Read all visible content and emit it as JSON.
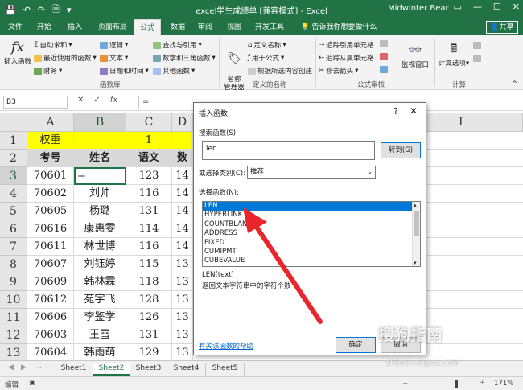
{
  "titlebar": {
    "title": "excel学生成绩单  [兼容模式]  -  Excel",
    "user": "Midwinter Bear",
    "save_icon": "save-icon",
    "undo_icon": "undo-icon",
    "redo_icon": "redo-icon",
    "new_icon": "new-file-icon",
    "customize_icon": "chevron-down-icon"
  },
  "tabs": [
    "文件",
    "开始",
    "插入",
    "页面布局",
    "公式",
    "数据",
    "审阅",
    "视图",
    "开发工具",
    "告诉我你想要做什么"
  ],
  "share_label": "共享",
  "ribbon": {
    "insert_function": "插入函数",
    "autosum": "自动求和",
    "recent": "最近使用的函数",
    "financial": "财务",
    "logical": "逻辑",
    "text": "文本",
    "datetime": "日期和时间",
    "lookup": "查找与引用",
    "math": "数学和三角函数",
    "more": "其他函数",
    "group_library": "函数库",
    "name_manager": "名称\n管理器",
    "define_name": "定义名称",
    "use_in_formula": "用于公式",
    "create_from_selection": "根据所选内容创建",
    "group_names": "定义的名称",
    "trace_precedents": "追踪引用单元格",
    "trace_dependents": "追踪从属单元格",
    "remove_arrows": "移去箭头",
    "group_audit": "公式审核",
    "watch_window": "监视窗口",
    "calc_options": "计算选项",
    "group_calc": "计算"
  },
  "formula_bar": {
    "namebox": "B3",
    "content": "="
  },
  "grid": {
    "columns": [
      "A",
      "B",
      "C",
      "D"
    ],
    "selected_column": "B",
    "row_numbers": [
      "1",
      "2",
      "3",
      "4",
      "5",
      "6",
      "7",
      "8",
      "9",
      "10",
      "11",
      "12",
      "13"
    ],
    "selected_row": "3",
    "row1": [
      "权重",
      "",
      "1",
      ""
    ],
    "headers": [
      "考号",
      "姓名",
      "语文",
      "数"
    ],
    "rows": [
      [
        "70601",
        "=",
        "123",
        "14"
      ],
      [
        "70602",
        "刘帅",
        "116",
        "14"
      ],
      [
        "70605",
        "杨璐",
        "131",
        "14"
      ],
      [
        "70616",
        "康惠雯",
        "114",
        "14"
      ],
      [
        "70611",
        "林世博",
        "116",
        "14"
      ],
      [
        "70607",
        "刘钰婷",
        "115",
        "13"
      ],
      [
        "70609",
        "韩林霖",
        "118",
        "13"
      ],
      [
        "70612",
        "苑宇飞",
        "128",
        "13"
      ],
      [
        "70606",
        "李鉴学",
        "126",
        "13"
      ],
      [
        "70603",
        "王雪",
        "131",
        "13"
      ],
      [
        "70604",
        "韩雨萌",
        "129",
        "13"
      ]
    ],
    "extra_col": "I"
  },
  "sheets": [
    "Sheet1",
    "Sheet2",
    "Sheet3",
    "Sheet4",
    "Sheet5"
  ],
  "active_sheet": "Sheet2",
  "status": {
    "mode": "编辑",
    "zoom": "171%"
  },
  "dialog": {
    "title": "插入函数",
    "search_label": "搜索函数(S):",
    "search_value": "len",
    "go_button": "转到(G)",
    "category_label": "或选择类别(C):",
    "category_value": "推荐",
    "select_label": "选择函数(N):",
    "functions": [
      "LEN",
      "HYPERLINK",
      "COUNTBLAN",
      "ADDRESS",
      "FIXED",
      "CUMIPMT",
      "CUBEVALUE"
    ],
    "selected_function": "LEN",
    "signature": "LEN(text)",
    "description": "返回文本字符串中的字符个数",
    "help_link": "有关该函数的帮助",
    "ok": "确定",
    "cancel": "取消",
    "help_glyph": "?",
    "close_glyph": "✕"
  },
  "watermark": {
    "brand": "搜狗指南",
    "url": "zhinan.sogou.com"
  },
  "colors": {
    "excel_green": "#217346",
    "yellow_fill": "#ffff00",
    "header_fill": "#d9d9d9",
    "selection_blue": "#0078d7",
    "arrow_red": "#e8262c"
  }
}
